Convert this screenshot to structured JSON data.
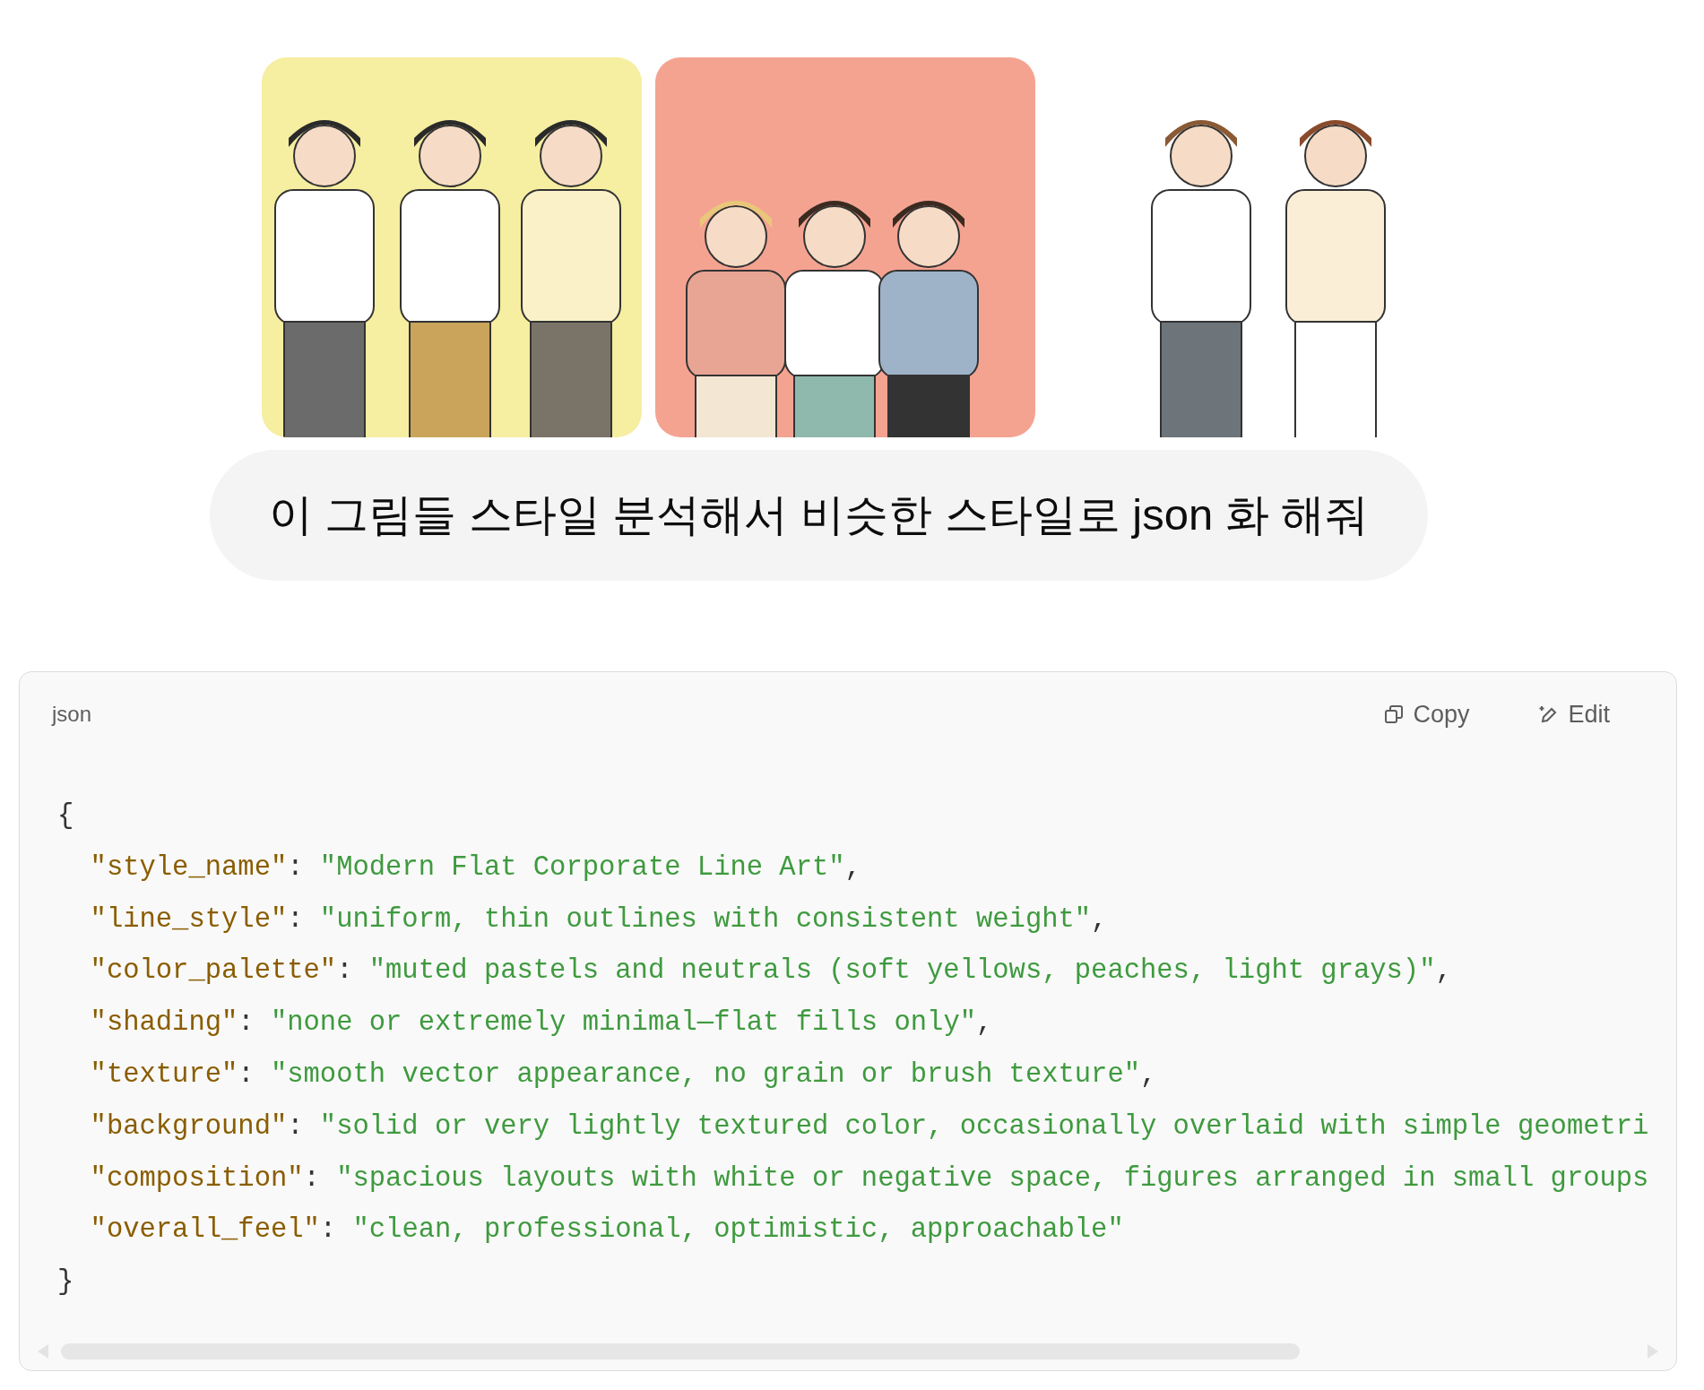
{
  "message": {
    "text": "이 그림들 스타일 분석해서 비슷한 스타일로 json 화 해줘"
  },
  "code_block": {
    "language": "json",
    "actions": [
      {
        "kind": "copy",
        "label": "Copy"
      },
      {
        "kind": "edit",
        "label": "Edit"
      }
    ],
    "lines": [
      {
        "kind": "punct",
        "text": "{"
      },
      {
        "kind": "entry",
        "key": "\"style_name\"",
        "sep": ":",
        "value": "\"Modern Flat Corporate Line Art\"",
        "tail": ","
      },
      {
        "kind": "entry",
        "key": "\"line_style\"",
        "sep": ":",
        "value": "\"uniform, thin outlines with consistent weight\"",
        "tail": ","
      },
      {
        "kind": "entry",
        "key": "\"color_palette\"",
        "sep": ":",
        "value": "\"muted pastels and neutrals (soft yellows, peaches, light grays)\"",
        "tail": ","
      },
      {
        "kind": "entry",
        "key": "\"shading\"",
        "sep": ":",
        "value": "\"none or extremely minimal—flat fills only\"",
        "tail": ","
      },
      {
        "kind": "entry",
        "key": "\"texture\"",
        "sep": ":",
        "value": "\"smooth vector appearance, no grain or brush texture\"",
        "tail": ","
      },
      {
        "kind": "entry",
        "key": "\"background\"",
        "sep": ":",
        "value": "\"solid or very lightly textured color, occasionally overlaid with simple geometri"
      },
      {
        "kind": "entry",
        "key": "\"composition\"",
        "sep": ":",
        "value": "\"spacious layouts with white or negative space, figures arranged in small groups"
      },
      {
        "kind": "entry",
        "key": "\"overall_feel\"",
        "sep": ":",
        "value": "\"clean, professional, optimistic, approachable\""
      },
      {
        "kind": "punct",
        "text": "}"
      }
    ]
  }
}
